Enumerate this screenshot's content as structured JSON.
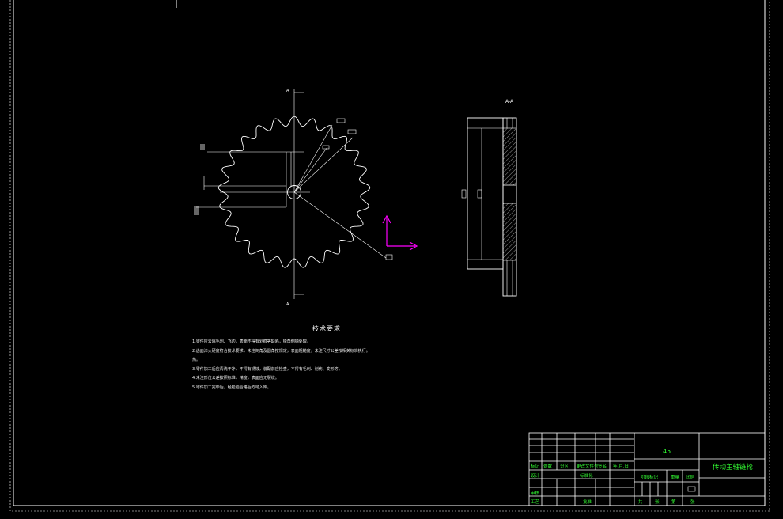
{
  "drawing": {
    "section_label": "A-A",
    "cut_marker_top": "A",
    "cut_marker_bottom": "A"
  },
  "gear": {
    "teeth": 25
  },
  "tech_requirements": {
    "title": "技术要求",
    "lines": [
      "1.零件应去除毛刺、飞边，表面不得有划痕等缺陷，锐角倒钝处理。",
      "2.齿面淬火硬度符合技术要求，未注倒角及圆角按规定，表面粗糙度，未注尺寸公差按相关标准执行。",
      "  热。",
      "3.零件加工后应清洗干净，不得有锈蚀，装配前应检查，不得有毛刺、划伤、变形等。",
      "4.未注形位公差按照标准，精度，表面应无裂纹。",
      "5.零件加工完毕后，经检验合格后方可入库。"
    ]
  },
  "title_block": {
    "material": "45",
    "part_name": "传动主轴链轮",
    "headers": {
      "mark": "标记",
      "count": "处数",
      "zone": "分区",
      "change_doc": "更改文件号",
      "signature": "签名",
      "date": "年.月.日",
      "design": "设计",
      "standardize": "标准化",
      "review": "审核",
      "craft": "工艺",
      "approve": "批准",
      "stage_mark": "阶段标记",
      "weight": "重量",
      "scale": "比例",
      "sheet_total": "共",
      "sheet_no": "第",
      "sheet_unit1": "张",
      "sheet_unit2": "张"
    }
  },
  "colors": {
    "background": "#000000",
    "line": "#ffffff",
    "title_text": "#33ff33",
    "ucs_icon": "#ff00ff"
  }
}
